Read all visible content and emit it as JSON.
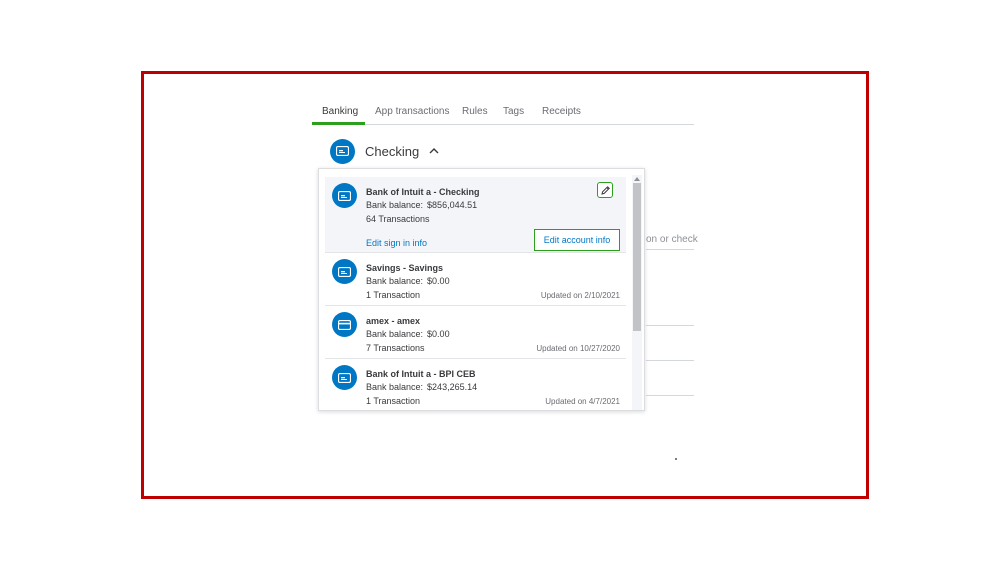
{
  "tabs": [
    {
      "label": "Banking",
      "active": true
    },
    {
      "label": "App transactions",
      "active": false
    },
    {
      "label": "Rules",
      "active": false
    },
    {
      "label": "Tags",
      "active": false
    },
    {
      "label": "Receipts",
      "active": false
    }
  ],
  "account_header": {
    "title": "Checking",
    "icon": "bank-card-icon",
    "caret_icon": "chevron-up-icon"
  },
  "background": {
    "search_text": "on or check"
  },
  "accounts": [
    {
      "name": "Bank of Intuit a - Checking",
      "balance_label": "Bank balance:",
      "balance": "$856,044.51",
      "transactions": "64 Transactions",
      "updated": "",
      "icon": "bank-card-icon"
    },
    {
      "name": "Savings - Savings",
      "balance_label": "Bank balance:",
      "balance": "$0.00",
      "transactions": "1 Transaction",
      "updated": "Updated on 2/10/2021",
      "icon": "bank-card-icon"
    },
    {
      "name": "amex - amex",
      "balance_label": "Bank balance:",
      "balance": "$0.00",
      "transactions": "7 Transactions",
      "updated": "Updated on 10/27/2020",
      "icon": "credit-card-icon"
    },
    {
      "name": "Bank of Intuit a - BPI CEB",
      "balance_label": "Bank balance:",
      "balance": "$243,265.14",
      "transactions": "1 Transaction",
      "updated": "Updated on 4/7/2021",
      "icon": "bank-card-icon"
    }
  ],
  "selected_actions": {
    "edit_sign_in": "Edit sign in info",
    "edit_account": "Edit account info",
    "pencil_icon": "pencil-icon"
  },
  "colors": {
    "accent_blue": "#0077c5",
    "accent_green": "#2ca01c",
    "frame_red": "#c00000"
  }
}
